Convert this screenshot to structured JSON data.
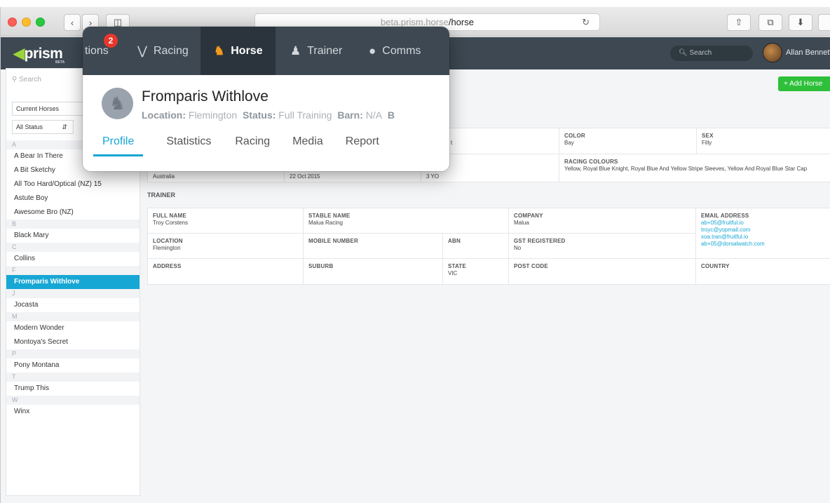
{
  "browser": {
    "url_dim": "beta.prism.horse",
    "url_rest": "/horse"
  },
  "app": {
    "logo": "prism",
    "logo_sub": "BETA",
    "search_placeholder": "Search",
    "user_name": "Allan Bennetto",
    "add_horse_label": "+ Add Horse"
  },
  "sidebar": {
    "search_placeholder": "Search",
    "filter": "Current Horses",
    "status": "All Status",
    "groups": [
      {
        "letter": "A",
        "items": [
          "A Bear In There",
          "A Bit Sketchy",
          "All Too Hard/Optical (NZ) 15",
          "Astute Boy",
          "Awesome Bro (NZ)"
        ]
      },
      {
        "letter": "B",
        "items": [
          "Black Mary"
        ]
      },
      {
        "letter": "C",
        "items": [
          "Collins"
        ]
      },
      {
        "letter": "F",
        "items": [
          "Fromparis Withlove"
        ]
      },
      {
        "letter": "J",
        "items": [
          "Jocasta"
        ]
      },
      {
        "letter": "M",
        "items": [
          "Modern Wonder",
          "Montoya's Secret"
        ]
      },
      {
        "letter": "P",
        "items": [
          "Pony Montana"
        ]
      },
      {
        "letter": "T",
        "items": [
          "Trump This"
        ]
      },
      {
        "letter": "W",
        "items": [
          "Winx"
        ]
      }
    ],
    "active": "Fromparis Withlove"
  },
  "horse_info": {
    "peek_weight": "t",
    "color_label": "COLOR",
    "color": "Bay",
    "sex_label": "SEX",
    "sex": "Filly",
    "peek_country": "Australia",
    "peek_date": "22 Oct 2015",
    "peek_age": "3 YO",
    "racing_colours_label": "RACING COLOURS",
    "racing_colours": "Yellow, Royal Blue Knight, Royal Blue And Yellow Stripe Sleeves, Yellow And Royal Blue Star Cap"
  },
  "trainer": {
    "section_title": "TRAINER",
    "full_name_label": "FULL NAME",
    "full_name": "Troy Corstens",
    "stable_name_label": "STABLE NAME",
    "stable_name": "Malua Racing",
    "company_label": "COMPANY",
    "company": "Malua",
    "email_label": "EMAIL ADDRESS",
    "emails": [
      "ab+05@fruitful.io",
      "troyc@yopmail.com",
      "xoa.tran@fruitful.io",
      "ab+05@dorsalwatch.com"
    ],
    "location_label": "LOCATION",
    "location": "Flemington",
    "mobile_label": "MOBILE NUMBER",
    "mobile": "",
    "abn_label": "ABN",
    "abn": "",
    "gst_label": "GST REGISTERED",
    "gst": "No",
    "address_label": "ADDRESS",
    "address": "",
    "suburb_label": "SUBURB",
    "suburb": "",
    "state_label": "STATE",
    "state": "VIC",
    "postcode_label": "POST CODE",
    "postcode": "",
    "country_label": "COUNTRY",
    "country": ""
  },
  "popover": {
    "nav_partial": "tions",
    "badge": "2",
    "nav": [
      {
        "label": "Racing",
        "icon": "trophy-icon"
      },
      {
        "label": "Horse",
        "icon": "horse-icon"
      },
      {
        "label": "Trainer",
        "icon": "user-icon"
      },
      {
        "label": "Comms",
        "icon": "chat-icon"
      }
    ],
    "horse_name": "Fromparis Withlove",
    "location_label": "Location:",
    "location": "Flemington",
    "status_label": "Status:",
    "status": "Full Training",
    "barn_label": "Barn:",
    "barn": "N/A",
    "cut_label": "B",
    "tabs": [
      "Profile",
      "Statistics",
      "Racing",
      "Media",
      "Report"
    ],
    "active_tab": "Profile"
  }
}
